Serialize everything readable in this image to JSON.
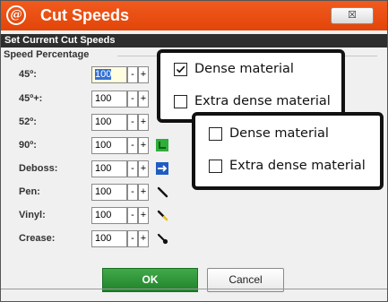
{
  "window": {
    "logo_text": "@",
    "title": "Cut Speeds",
    "close_label": "☒",
    "accent_color": "#e8500f"
  },
  "header": {
    "label": "Set Current Cut Speeds"
  },
  "group": {
    "title": "Speed Percentage"
  },
  "rows": [
    {
      "label": "45º:",
      "value": "100",
      "minus": "-",
      "plus": "+",
      "icon": "none",
      "selected": true
    },
    {
      "label": "45º+:",
      "value": "100",
      "minus": "-",
      "plus": "+",
      "icon": "none"
    },
    {
      "label": "52º:",
      "value": "100",
      "minus": "-",
      "plus": "+",
      "icon": "none"
    },
    {
      "label": "90º:",
      "value": "100",
      "minus": "-",
      "plus": "+",
      "icon": "corner-tool-icon"
    },
    {
      "label": "Deboss:",
      "value": "100",
      "minus": "-",
      "plus": "+",
      "icon": "deboss-tool-icon"
    },
    {
      "label": "Pen:",
      "value": "100",
      "minus": "-",
      "plus": "+",
      "icon": "pen-tool-icon"
    },
    {
      "label": "Vinyl:",
      "value": "100",
      "minus": "-",
      "plus": "+",
      "icon": "vinyl-tool-icon"
    },
    {
      "label": "Crease:",
      "value": "100",
      "minus": "-",
      "plus": "+",
      "icon": "crease-tool-icon"
    }
  ],
  "buttons": {
    "ok": "OK",
    "cancel": "Cancel"
  },
  "callout_top": {
    "options": [
      {
        "label": "Dense material",
        "checked": true
      },
      {
        "label": "Extra dense material",
        "checked": false
      }
    ]
  },
  "callout_bottom": {
    "options": [
      {
        "label": "Dense material",
        "checked": false
      },
      {
        "label": "Extra dense material",
        "checked": false
      }
    ]
  }
}
